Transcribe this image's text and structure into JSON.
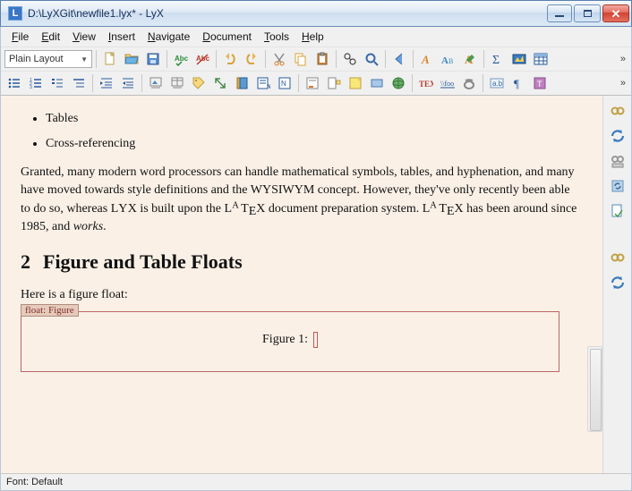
{
  "window": {
    "title": "D:\\LyXGit\\newfile1.lyx* - LyX",
    "app_initial": "L"
  },
  "menu": {
    "file": "File",
    "edit": "Edit",
    "view": "View",
    "insert": "Insert",
    "navigate": "Navigate",
    "document": "Document",
    "tools": "Tools",
    "help": "Help"
  },
  "toolbar": {
    "layout": "Plain Layout",
    "overflow": "»"
  },
  "doc": {
    "bullet1": "Tables",
    "bullet2": "Cross-referencing",
    "para1_a": "Granted, many modern word processors can handle mathematical symbols, tables, and hyphenation, and many have moved towards style definitions and the WYSIWYM concept. However, they've only recently been able to do so, whereas ",
    "para1_b": " is built upon the ",
    "para1_c": " document preparation system. ",
    "para1_d": " has been around since 1985, and ",
    "para1_e": ".",
    "lyx_text": "LYX",
    "latex_l": "L",
    "latex_a": "A",
    "latex_t": "T",
    "latex_e": "E",
    "latex_x": "X",
    "works": "works",
    "section_num": "2",
    "section_title": "Figure and Table Floats",
    "intro": "Here is a figure float:",
    "float_label": "float: Figure",
    "caption_label": "Figure 1:"
  },
  "status": {
    "text": "Font: Default"
  }
}
